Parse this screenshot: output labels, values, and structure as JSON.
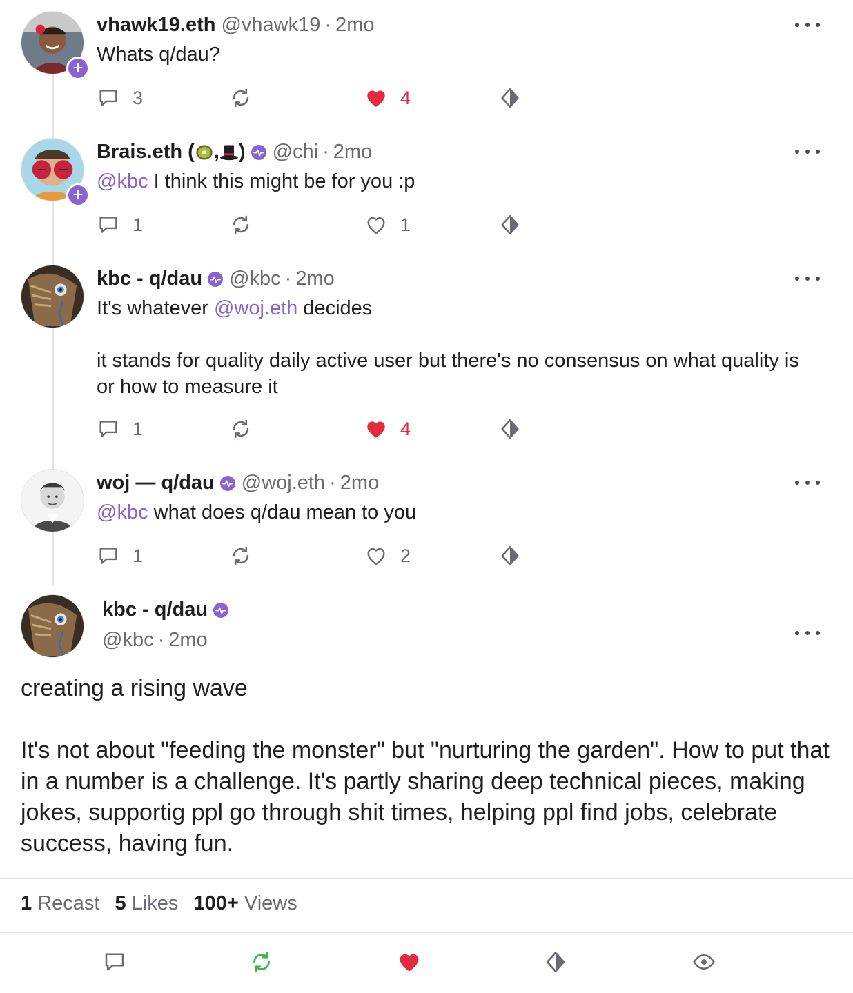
{
  "colors": {
    "accent": "#8a63d2",
    "like": "#e02c3c",
    "recast_active": "#3cb34a",
    "muted": "#6b6b73"
  },
  "replies": [
    {
      "name": "vhawk19.eth",
      "handle": "@vhawk19",
      "time": "2mo",
      "verified": false,
      "body": [
        "Whats q/dau?"
      ],
      "comments": "3",
      "likes": "4",
      "liked": true
    },
    {
      "name_prefix": "Brais.eth (",
      "name_sep": ",",
      "name_suffix": ")",
      "emojis": [
        "kiwi-emoji",
        "top-hat-emoji"
      ],
      "handle": "@chi",
      "time": "2mo",
      "verified": true,
      "mention": "@kbc",
      "body_after_mention": " I think this might be for you :p",
      "comments": "1",
      "likes": "1",
      "liked": false
    },
    {
      "name": "kbc - q/dau",
      "handle": "@kbc",
      "time": "2mo",
      "verified": true,
      "body_pre": "It's whatever ",
      "mention": "@woj.eth",
      "body_post": " decides",
      "body2": "it stands for quality daily active user but there's no consensus on what quality is or how to measure it",
      "comments": "1",
      "likes": "4",
      "liked": true
    },
    {
      "name": "woj — q/dau",
      "handle": "@woj.eth",
      "time": "2mo",
      "verified": true,
      "mention": "@kbc",
      "body_after_mention": " what does q/dau mean to you",
      "comments": "1",
      "likes": "2",
      "liked": false
    }
  ],
  "main": {
    "name": "kbc - q/dau",
    "handle": "@kbc",
    "time": "2mo",
    "text1": "creating a rising wave",
    "text2": "It's not about \"feeding the monster\" but \"nurturing the garden\". How to put that in a number is a challenge. It's partly sharing deep technical pieces, making jokes, supportig ppl go through shit times, helping ppl find jobs, celebrate success, having fun."
  },
  "stats": {
    "recasts_count": "1",
    "recasts_label": "Recast",
    "likes_count": "5",
    "likes_label": "Likes",
    "views_count": "100+",
    "views_label": "Views"
  },
  "separator": "·",
  "bottom_bar": [
    "comment-icon",
    "recast-icon",
    "heart-icon",
    "tip-icon",
    "eye-icon"
  ]
}
